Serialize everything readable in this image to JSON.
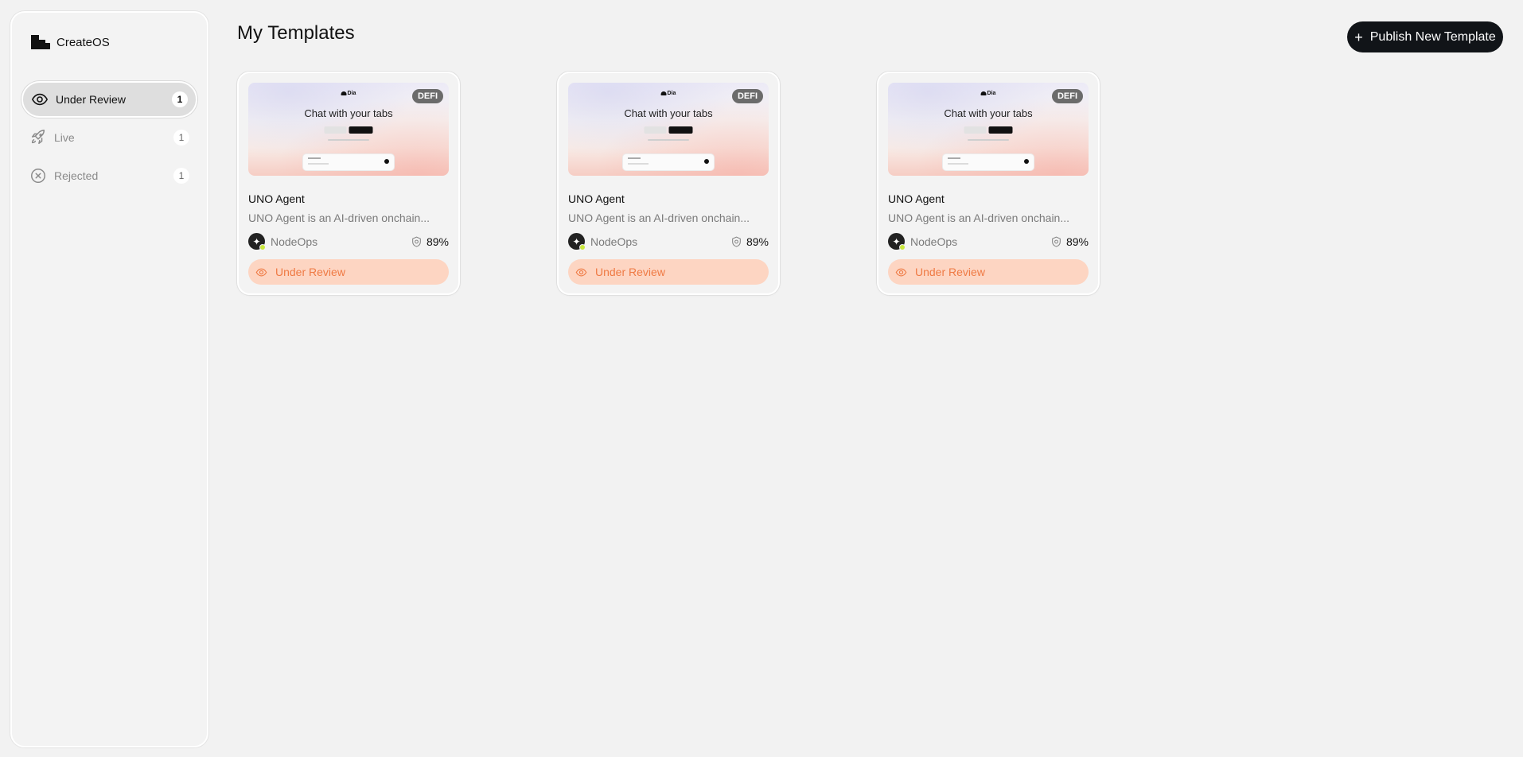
{
  "brand": {
    "name": "CreateOS",
    "icon": "createos-logo-icon"
  },
  "sidebar": {
    "items": [
      {
        "label": "Under Review",
        "count": "1",
        "icon": "eye-icon",
        "active": true
      },
      {
        "label": "Live",
        "count": "1",
        "icon": "rocket-icon",
        "active": false
      },
      {
        "label": "Rejected",
        "count": "1",
        "icon": "x-circle-icon",
        "active": false
      }
    ]
  },
  "header": {
    "title": "My Templates",
    "publish_label": "Publish New Template",
    "publish_icon": "plus-icon"
  },
  "cards": [
    {
      "badge": "DEFI",
      "preview_logo": "Dia",
      "preview_headline": "Chat with your tabs",
      "title": "UNO Agent",
      "description": "UNO Agent is an AI-driven onchain...",
      "author": "NodeOps",
      "score": "89%",
      "status": "Under Review"
    },
    {
      "badge": "DEFI",
      "preview_logo": "Dia",
      "preview_headline": "Chat with your tabs",
      "title": "UNO Agent",
      "description": "UNO Agent is an AI-driven onchain...",
      "author": "NodeOps",
      "score": "89%",
      "status": "Under Review"
    },
    {
      "badge": "DEFI",
      "preview_logo": "Dia",
      "preview_headline": "Chat with your tabs",
      "title": "UNO Agent",
      "description": "UNO Agent is an AI-driven onchain...",
      "author": "NodeOps",
      "score": "89%",
      "status": "Under Review"
    }
  ],
  "colors": {
    "accent_dark": "#111418",
    "status_bg": "#fdd5c2",
    "status_text": "#ef7a44",
    "badge_bg": "#6b6b6b",
    "online": "#c8e63c"
  }
}
